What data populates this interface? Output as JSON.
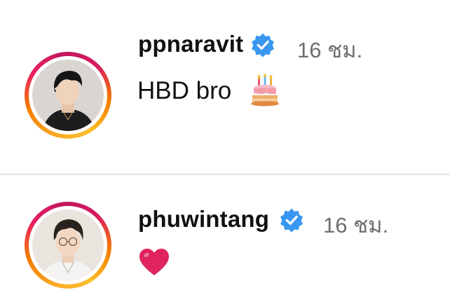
{
  "comments": [
    {
      "username": "ppnaravit",
      "timestamp": "16 ชม.",
      "text": "HBD bro",
      "emoji_icon": "birthday-cake-icon",
      "verified": true
    },
    {
      "username": "phuwintang",
      "timestamp": "16 ชม.",
      "text": "",
      "emoji_icon": "red-heart-icon",
      "verified": true
    }
  ],
  "colors": {
    "verified_badge": "#3897f0",
    "timestamp": "#6e6e6e",
    "divider": "#e4e4e4",
    "story_ring_start": "#f9a825",
    "story_ring_end": "#d81b60",
    "heart": "#e0245e"
  }
}
